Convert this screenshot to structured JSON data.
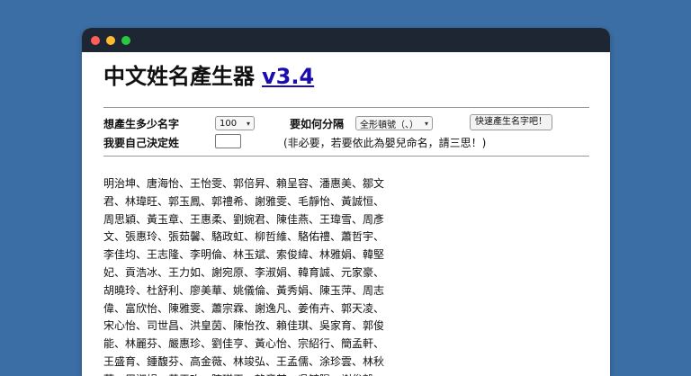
{
  "window": {
    "title_text": "中文姓名產生器",
    "version_link": "v3.4"
  },
  "form": {
    "count_label": "想產生多少名字",
    "count_value": "100",
    "separator_label": "要如何分隔",
    "separator_value": "全形頓號（、）",
    "generate_button": "快速產生名字吧！",
    "surname_label": "我要自己決定姓",
    "surname_value": "",
    "note": "(非必要，若要依此為嬰兒命名，請三思！)"
  },
  "names_text": "明治坤、唐海怡、王怡雯、郭倍昇、賴呈容、潘惠美、鄒文君、林瑋旺、郭玉鳳、郭禮希、謝雅雯、毛靜怡、黃誠恒、周思穎、黃玉章、王惠柔、劉婉君、陳佳燕、王瑋雪、周彥文、張惠玲、張茹馨、駱政虹、柳哲維、駱佑禮、蕭哲宇、李佳均、王志隆、李明倫、林玉斌、索俊緯、林雅娟、韓堅妃、貢浩冰、王力如、謝宛原、李淑娟、韓育誠、元家豪、胡曉玲、杜舒利、廖美華、姚儀倫、黃秀娟、陳玉萍、周志偉、富欣怡、陳雅雯、蕭宗霖、謝逸凡、姜侑卉、郭天凌、宋心怡、司世昌、洪皇茵、陳怡孜、賴佳琪、吳家育、郭俊能、林麗芬、嚴惠珍、劉佳亨、黃心怡、宗紹行、簡孟軒、王盛育、鍾馥芬、高金薇、林竣弘、王孟儒、涂珍雲、林秋萍、周淑娟、黃于玫、陳琪平、賴彥其、吳毓陽、謝俊毅、"
}
